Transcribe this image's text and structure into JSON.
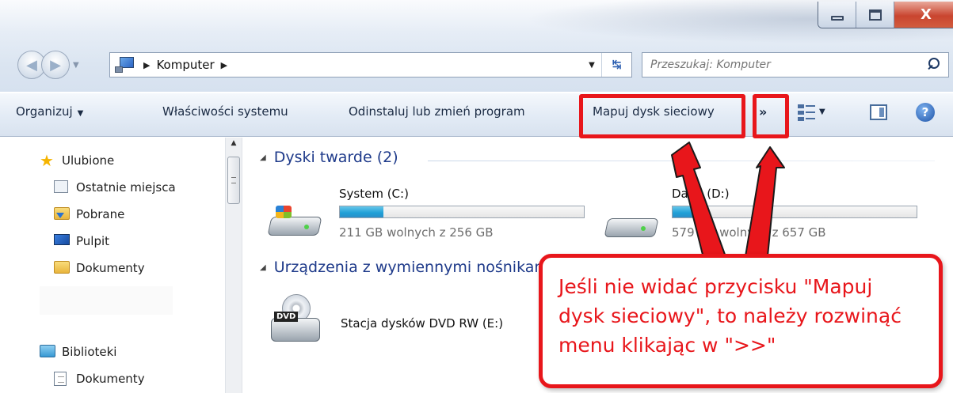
{
  "window": {
    "minimize_glyph": "min",
    "maximize_glyph": "max",
    "close_label": "X"
  },
  "address": {
    "crumb": "Komputer"
  },
  "search": {
    "placeholder": "Przeszukaj: Komputer"
  },
  "toolbar": {
    "organize": "Organizuj",
    "system_properties": "Właściwości systemu",
    "uninstall": "Odinstaluj lub zmień program",
    "map_drive": "Mapuj dysk sieciowy",
    "more": "»",
    "help": "?"
  },
  "sidebar": {
    "favorites": "Ulubione",
    "recent": "Ostatnie miejsca",
    "downloads": "Pobrane",
    "desktop": "Pulpit",
    "documents": "Dokumenty",
    "libraries": "Biblioteki",
    "lib_documents": "Dokumenty"
  },
  "content": {
    "hard_drives_header": "Dyski twarde (2)",
    "drives": [
      {
        "name": "System (C:)",
        "free": "211 GB wolnych z 256 GB",
        "used_fraction": 0.18
      },
      {
        "name": "Dane (D:)",
        "free": "579 GB wolnych z 657 GB",
        "used_fraction": 0.12
      }
    ],
    "removable_header": "Urządzenia z wymiennymi nośnikami (1)",
    "dvd_name": "Stacja dysków DVD RW (E:)",
    "dvd_label": "DVD"
  },
  "annotation": {
    "text": "Jeśli nie widać przycisku \"Mapuj dysk sieciowy\", to należy rozwinąć menu klikając w \">>\"",
    "color": "#e8161b"
  }
}
